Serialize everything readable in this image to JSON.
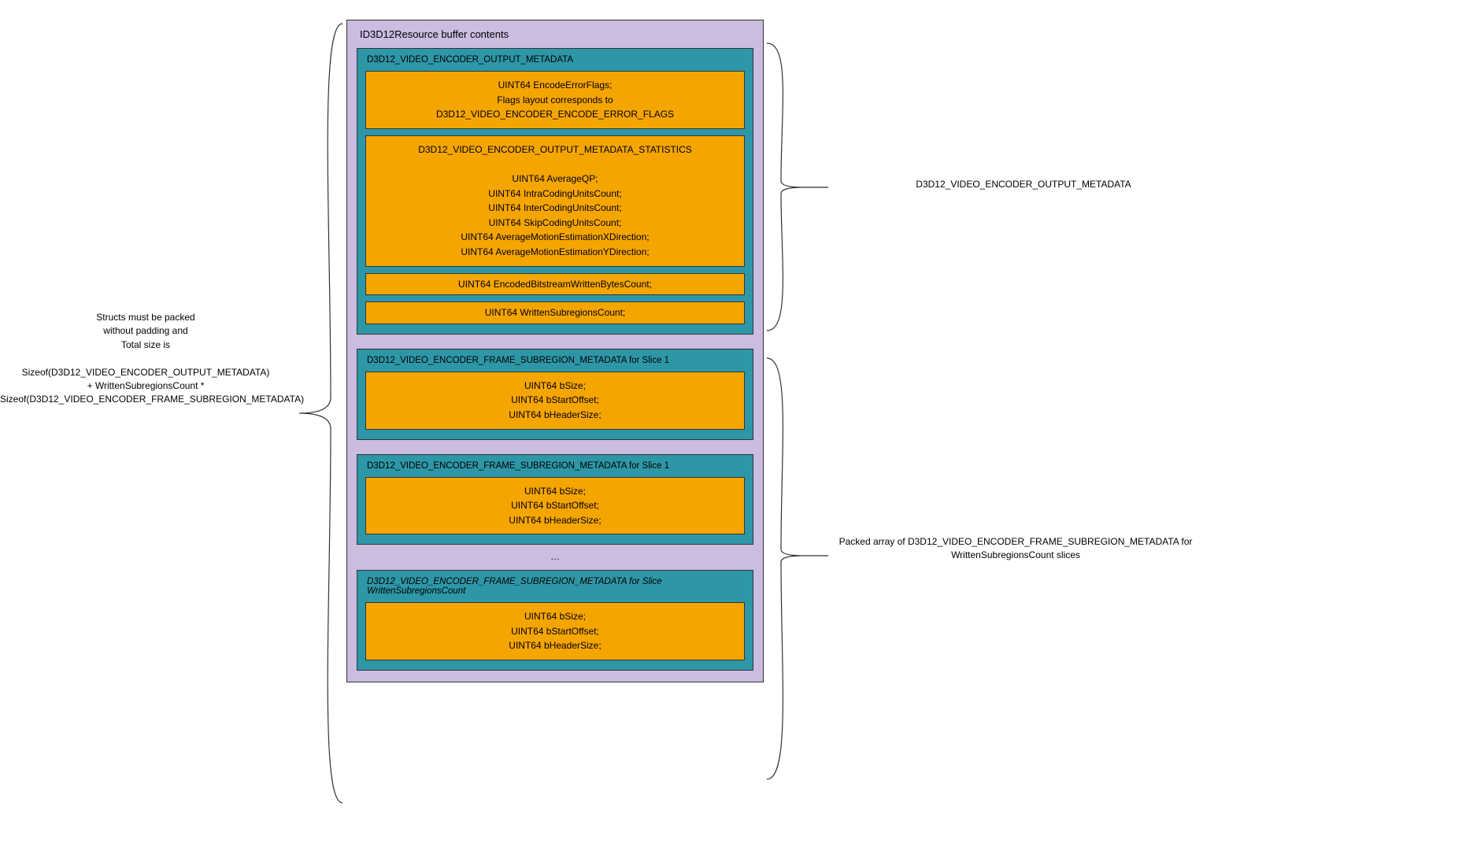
{
  "outer_title": "ID3D12Resource buffer contents",
  "left_note": {
    "l1": "Structs must be packed",
    "l2": "without padding and",
    "l3": "Total size is",
    "l4": "",
    "l5": "Sizeof(D3D12_VIDEO_ENCODER_OUTPUT_METADATA)",
    "l6": "+ WrittenSubregionsCount *",
    "l7": "Sizeof(D3D12_VIDEO_ENCODER_FRAME_SUBREGION_METADATA)"
  },
  "right_top": "D3D12_VIDEO_ENCODER_OUTPUT_METADATA",
  "right_bottom": {
    "l1": "Packed array of D3D12_VIDEO_ENCODER_FRAME_SUBREGION_METADATA for",
    "l2": "WrittenSubregionsCount slices"
  },
  "metadata_box": {
    "title": "D3D12_VIDEO_ENCODER_OUTPUT_METADATA",
    "error_flags": {
      "l1": "UINT64 EncodeErrorFlags;",
      "l2": "Flags layout corresponds to",
      "l3": "D3D12_VIDEO_ENCODER_ENCODE_ERROR_FLAGS"
    },
    "stats": {
      "title": "D3D12_VIDEO_ENCODER_OUTPUT_METADATA_STATISTICS",
      "l1": "UINT64 AverageQP;",
      "l2": "UINT64 IntraCodingUnitsCount;",
      "l3": "UINT64 InterCodingUnitsCount;",
      "l4": "UINT64 SkipCodingUnitsCount;",
      "l5": "UINT64 AverageMotionEstimationXDirection;",
      "l6": "UINT64 AverageMotionEstimationYDirection;"
    },
    "encoded_bytes": "UINT64 EncodedBitstreamWrittenBytesCount;",
    "written_subregions": "UINT64 WrittenSubregionsCount;"
  },
  "slice_title_1": "D3D12_VIDEO_ENCODER_FRAME_SUBREGION_METADATA for Slice 1",
  "slice_title_2": "D3D12_VIDEO_ENCODER_FRAME_SUBREGION_METADATA for Slice 1",
  "slice_title_n_l1": "D3D12_VIDEO_ENCODER_FRAME_SUBREGION_METADATA for Slice",
  "slice_title_n_l2": "WrittenSubregionsCount",
  "slice_fields": {
    "l1": "UINT64 bSize;",
    "l2": "UINT64 bStartOffset;",
    "l3": "UINT64 bHeaderSize;"
  },
  "ellipsis": "…"
}
